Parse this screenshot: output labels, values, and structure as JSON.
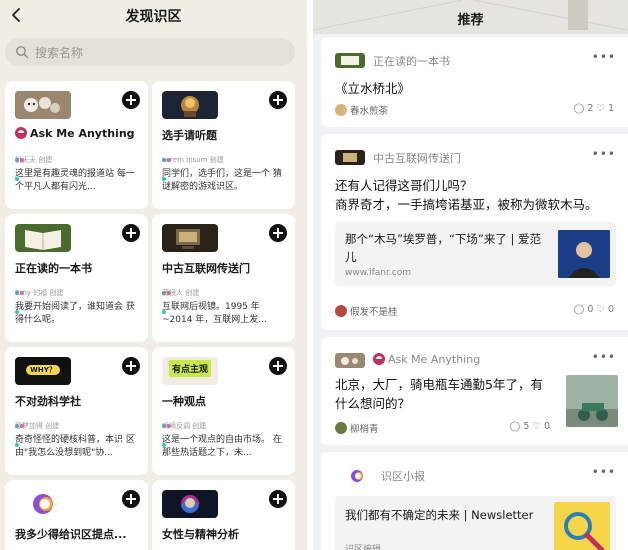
{
  "left": {
    "title": "发现识区",
    "search_placeholder": "搜索名称",
    "cards": [
      {
        "name": "Ask Me Anything",
        "creator": "桃夭夭 创建",
        "desc": "这里是有趣灵魂的报道站 每一个平凡人都有闪光..."
      },
      {
        "name": "选手请听题",
        "creator": "Lorem Ipsum 创建",
        "desc": "同学们，选手们，这是一个 猜谜解密的游戏识区。"
      },
      {
        "name": "正在读的一本书",
        "creator": "Tony 的福 创建",
        "desc": "我要开始阅读了，谁知道会 获得什么呢。"
      },
      {
        "name": "中古互联网传送门",
        "creator": "藏镜人 创建",
        "desc": "互联网后视镜。1995 年 ~2014 年，互联网上发..."
      },
      {
        "name": "不对劲科学社",
        "creator": "耶梦加得 创建",
        "desc": "奇奇怪怪的硬核科普，本识 区由\"我怎么没想到呢\"协...",
        "thumb_text": "WHY？"
      },
      {
        "name": "一种观点",
        "creator": "嘀嘀反调 创建",
        "desc": "这是一个观点的自由市场。 在那些热话题之下，未...",
        "thumb_text": "有点主观"
      },
      {
        "name": "我多少得给识区提点..."
      },
      {
        "name": "女性与精神分析"
      }
    ]
  },
  "right": {
    "title": "推荐",
    "posts": [
      {
        "zone": "正在读的一本书",
        "text": "《立水桥北》",
        "author": "春水煎茶",
        "comments": "2",
        "likes": "1"
      },
      {
        "zone": "中古互联网传送门",
        "text_line1": "还有人记得这哥们儿吗？",
        "text_line2": "商界奇才，一手搞垮诺基亚，被称为微软木马。",
        "link_title": "那个“木马”埃罗普，“下场”来了 | 爱范儿",
        "link_url": "www.ifanr.com",
        "author": "假发不是桂",
        "comments": "0",
        "likes": "0"
      },
      {
        "zone": "Ask Me Anything",
        "text_line1": "北京，大厂，骑电瓶车通勤5年了，有",
        "text_line2": "什么想问的？",
        "author": "柳梢青",
        "comments": "5",
        "likes": "0"
      },
      {
        "zone": "识区小报",
        "link_title": "我们都有不确定的未来 | Newsletter",
        "link_sub": "识区编辑"
      }
    ]
  },
  "colors": {
    "accent_red": "#c0315e",
    "dot_blue": "#3ba0e6",
    "dot_pink": "#e65a9a",
    "dot_teal": "#2cc7b5"
  }
}
